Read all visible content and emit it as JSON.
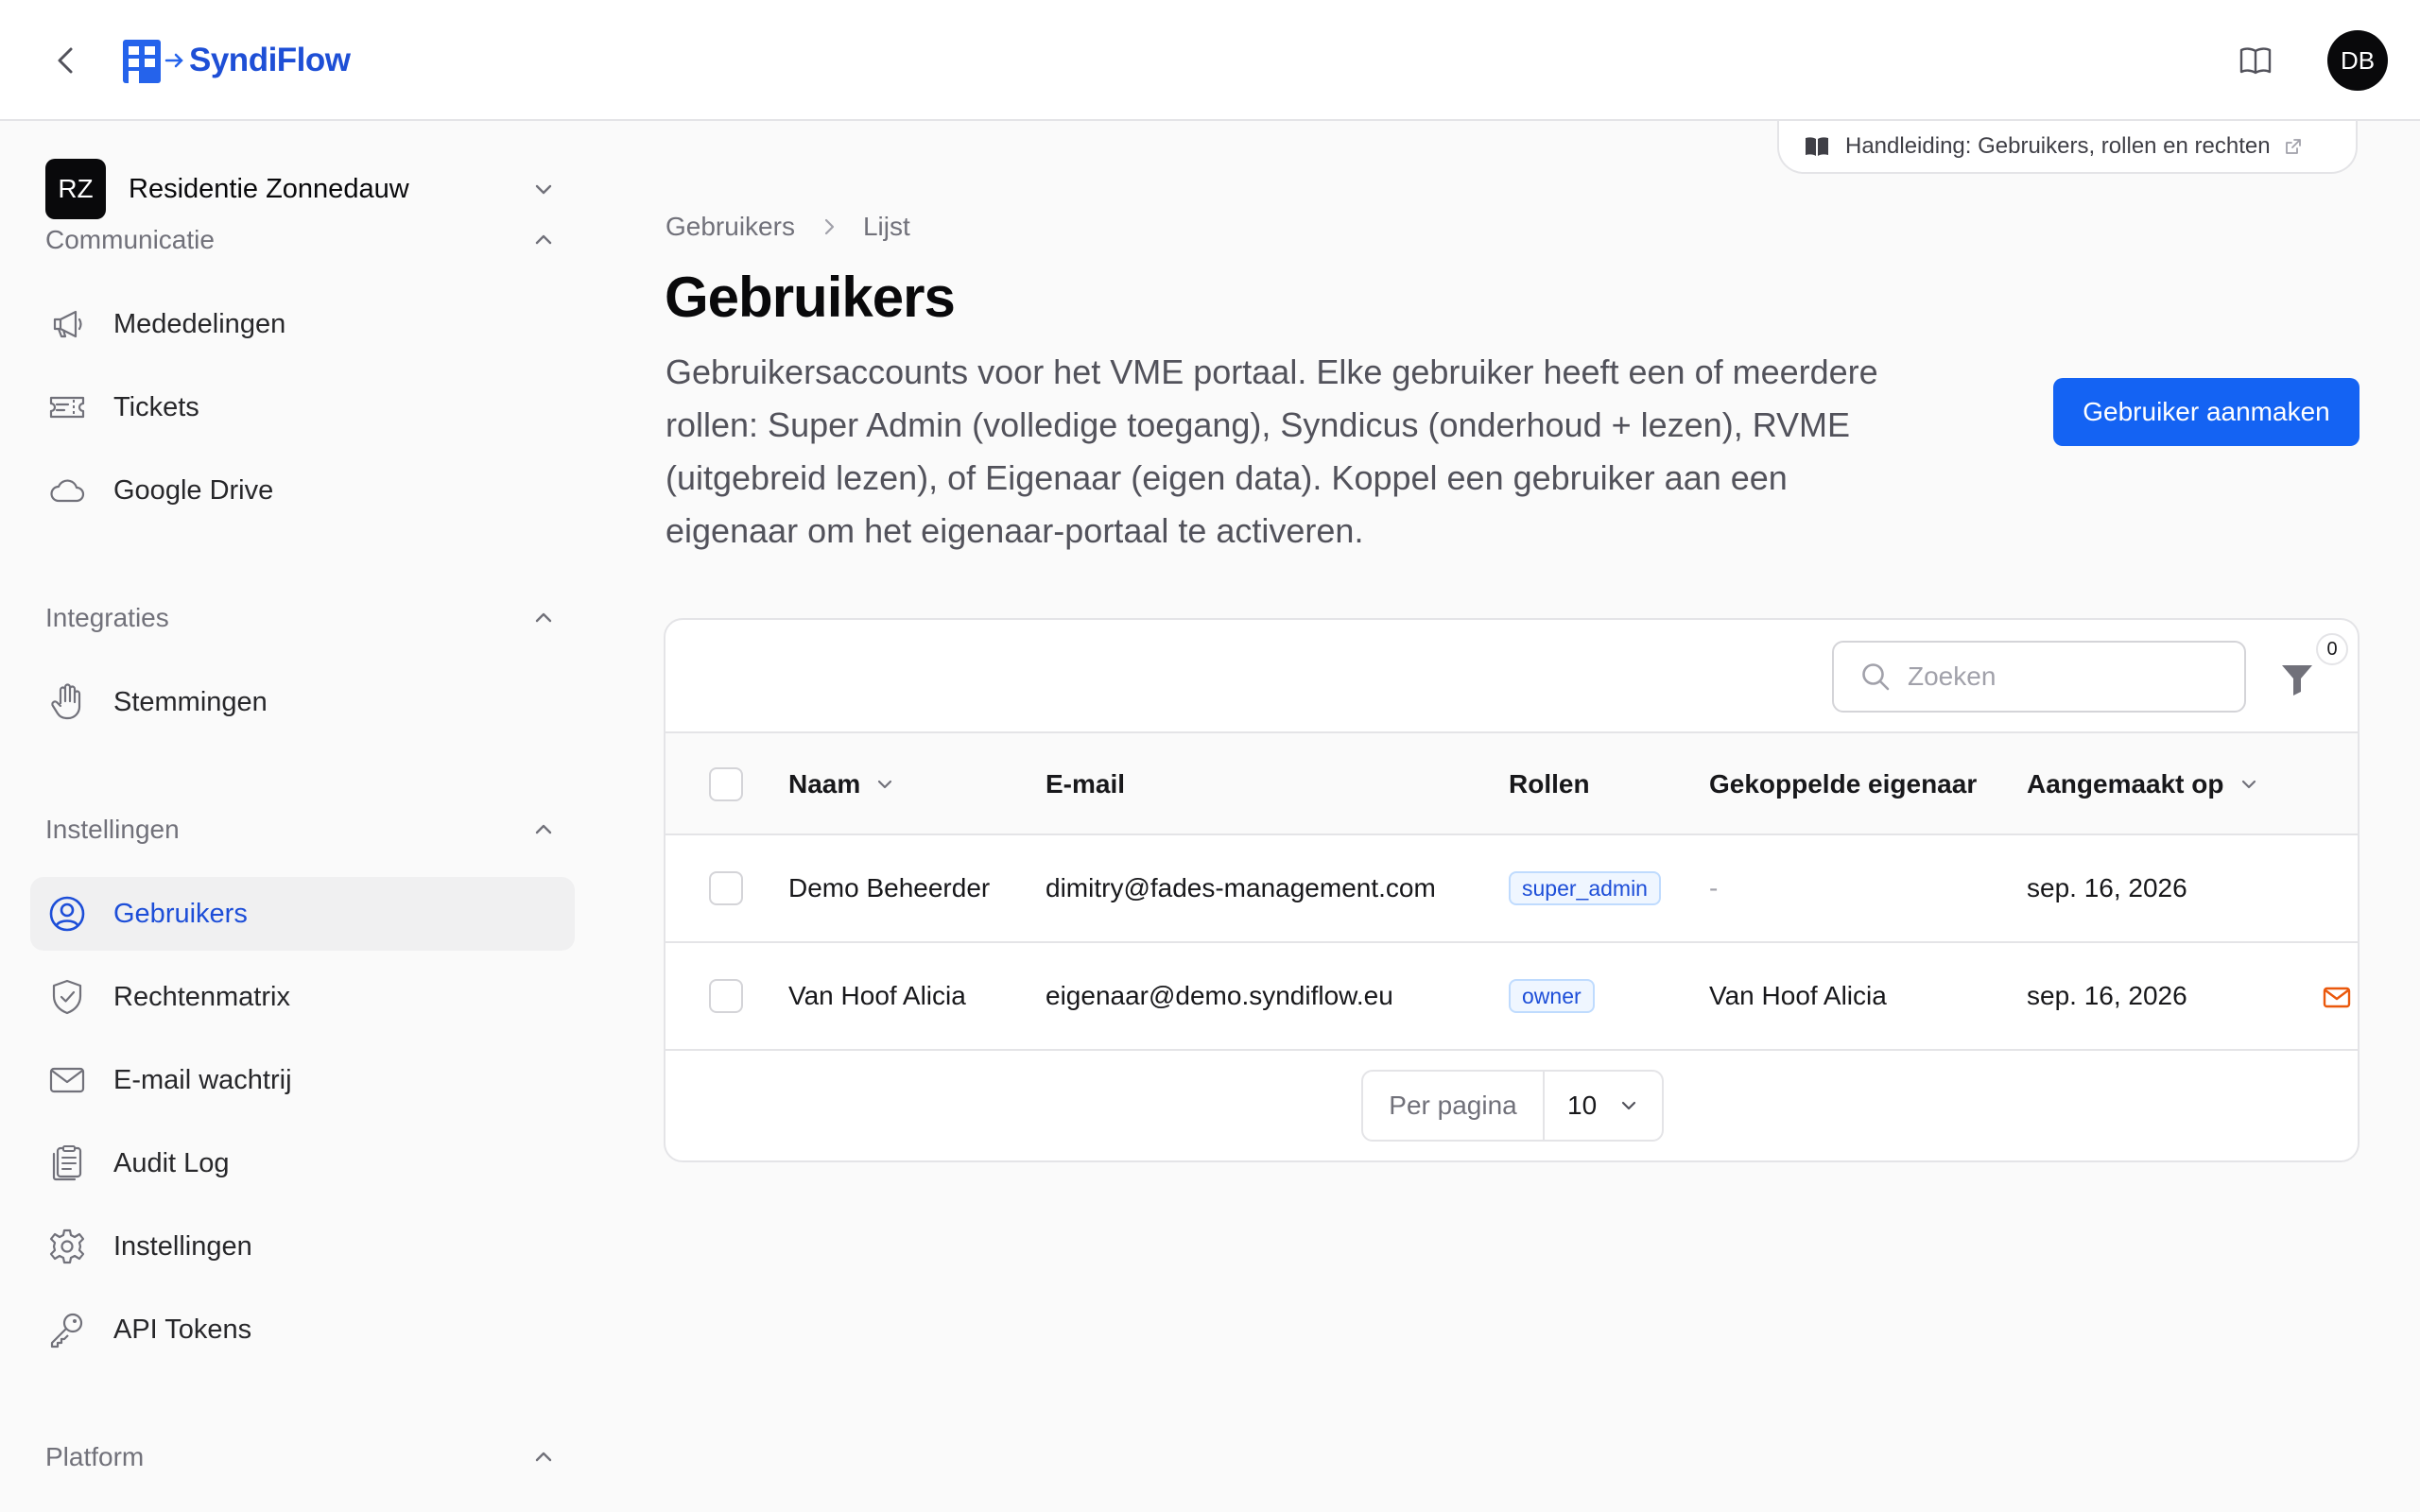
{
  "app": {
    "brand": "SyndiFlow",
    "user_initials": "DB",
    "accent": "#1463f3"
  },
  "tenant": {
    "initials": "RZ",
    "name": "Residentie Zonnedauw"
  },
  "sidebar": {
    "groups": [
      {
        "title": "Communicatie",
        "items": [
          {
            "label": "Mededelingen",
            "icon": "megaphone-icon"
          },
          {
            "label": "Tickets",
            "icon": "ticket-icon"
          },
          {
            "label": "Google Drive",
            "icon": "cloud-icon"
          }
        ]
      },
      {
        "title": "Integraties",
        "items": [
          {
            "label": "Stemmingen",
            "icon": "hand-icon"
          }
        ]
      },
      {
        "title": "Instellingen",
        "items": [
          {
            "label": "Gebruikers",
            "icon": "user-circle-icon",
            "active": true
          },
          {
            "label": "Rechtenmatrix",
            "icon": "shield-check-icon"
          },
          {
            "label": "E-mail wachtrij",
            "icon": "envelope-icon"
          },
          {
            "label": "Audit Log",
            "icon": "clipboard-icon"
          },
          {
            "label": "Instellingen",
            "icon": "gear-icon"
          },
          {
            "label": "API Tokens",
            "icon": "key-icon"
          }
        ]
      },
      {
        "title": "Platform",
        "items": []
      }
    ]
  },
  "doc_link": {
    "label": "Handleiding: Gebruikers, rollen en rechten"
  },
  "breadcrumbs": [
    "Gebruikers",
    "Lijst"
  ],
  "page": {
    "title": "Gebruikers",
    "description": "Gebruikersaccounts voor het VME portaal. Elke gebruiker heeft een of meerdere rollen: Super Admin (volledige toegang), Syndicus (onderhoud + lezen), RVME (uitgebreid lezen), of Eigenaar (eigen data). Koppel een gebruiker aan een eigenaar om het eigenaar-portaal te activeren.",
    "create_button": "Gebruiker aanmaken"
  },
  "table": {
    "search_placeholder": "Zoeken",
    "filter_count": "0",
    "columns": [
      "Naam",
      "E-mail",
      "Rollen",
      "Gekoppelde eigenaar",
      "Aangemaakt op"
    ],
    "rows": [
      {
        "name": "Demo Beheerder",
        "email": "dimitry@fades-management.com",
        "role": "super_admin",
        "owner": "-",
        "created": "sep. 16, 2026"
      },
      {
        "name": "Van Hoof Alicia",
        "email": "eigenaar@demo.syndiflow.eu",
        "role": "owner",
        "owner": "Van Hoof Alicia",
        "created": "sep. 16, 2026"
      }
    ],
    "per_page_label": "Per pagina",
    "per_page_value": "10"
  }
}
